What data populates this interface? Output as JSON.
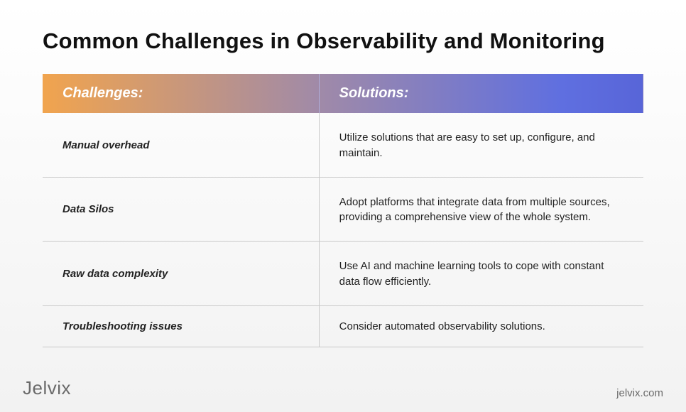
{
  "title": "Common Challenges in Observability and Monitoring",
  "headers": {
    "challenges": "Challenges:",
    "solutions": "Solutions:"
  },
  "rows": [
    {
      "challenge": "Manual overhead",
      "solution": "Utilize solutions that are easy to set up, configure, and maintain."
    },
    {
      "challenge": "Data Silos",
      "solution": "Adopt platforms that integrate data from multiple sources, providing a comprehensive view of the whole system."
    },
    {
      "challenge": "Raw data complexity",
      "solution": "Use AI and machine learning tools to cope with constant data flow efficiently."
    },
    {
      "challenge": "Troubleshooting issues",
      "solution": "Consider automated observability solutions."
    }
  ],
  "footer": {
    "logo": "Jelvix",
    "site": "jelvix.com"
  }
}
